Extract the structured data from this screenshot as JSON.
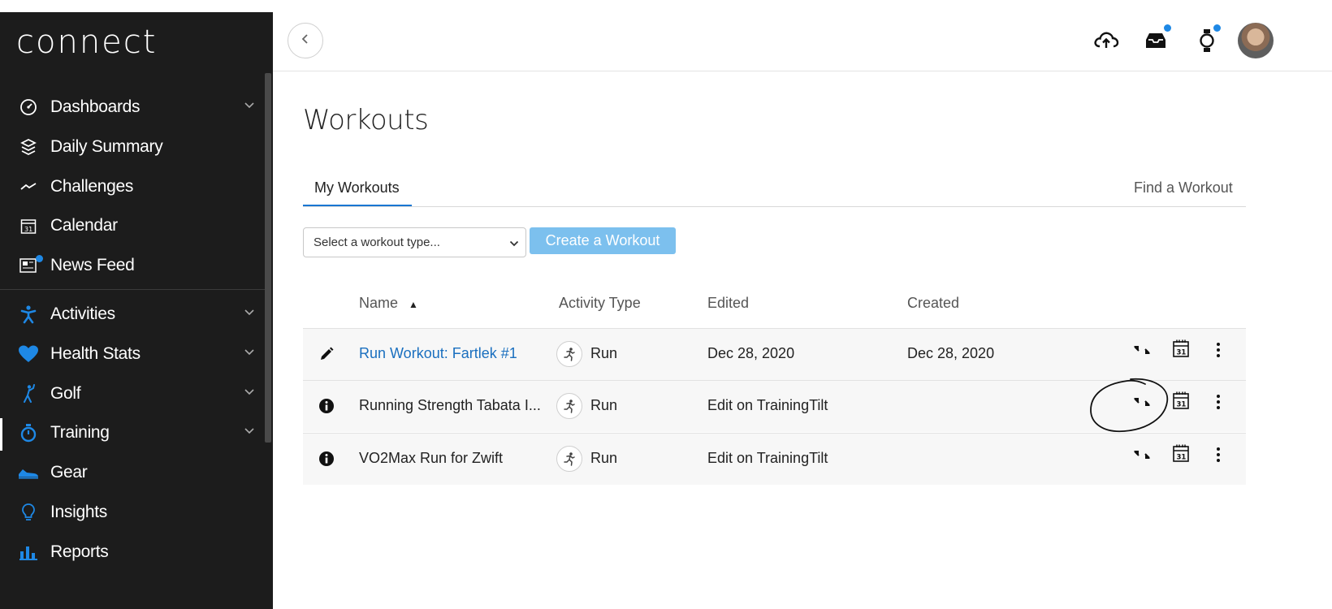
{
  "app": {
    "logo": "connect"
  },
  "sidebar": {
    "items": [
      {
        "label": "Dashboards",
        "icon": "gauge-icon",
        "chevron": true
      },
      {
        "label": "Daily Summary",
        "icon": "layers-icon",
        "chevron": false
      },
      {
        "label": "Challenges",
        "icon": "trend-icon",
        "chevron": false
      },
      {
        "label": "Calendar",
        "icon": "calendar-icon",
        "chevron": false
      },
      {
        "label": "News Feed",
        "icon": "newspaper-icon",
        "chevron": false
      },
      {
        "label": "Activities",
        "icon": "runner-icon",
        "chevron": true
      },
      {
        "label": "Health Stats",
        "icon": "heart-icon",
        "chevron": true
      },
      {
        "label": "Golf",
        "icon": "golf-icon",
        "chevron": true
      },
      {
        "label": "Training",
        "icon": "stopwatch-icon",
        "chevron": true,
        "active": true
      },
      {
        "label": "Gear",
        "icon": "shoe-icon",
        "chevron": false
      },
      {
        "label": "Insights",
        "icon": "lightbulb-icon",
        "chevron": false
      },
      {
        "label": "Reports",
        "icon": "bar-chart-icon",
        "chevron": false
      }
    ],
    "accent_color": "#1e88e5"
  },
  "topbar": {
    "icons": [
      "cloud-upload-icon",
      "inbox-icon",
      "watch-icon",
      "avatar"
    ]
  },
  "main": {
    "title": "Workouts",
    "tabs": [
      {
        "label": "My Workouts",
        "active": true
      },
      {
        "label": "Find a Workout",
        "active": false
      }
    ],
    "select": {
      "value": "Select a workout type..."
    },
    "create_button": "Create a Workout",
    "table": {
      "headers": {
        "name": "Name",
        "sort_arrow": "▲",
        "activity_type": "Activity Type",
        "edited": "Edited",
        "created": "Created"
      },
      "rows": [
        {
          "icon": "pencil-icon",
          "name": "Run Workout: Fartlek #1",
          "name_is_link": true,
          "activity": "Run",
          "edited": "Dec 28, 2020",
          "created": "Dec 28, 2020"
        },
        {
          "icon": "info-icon",
          "name": "Running Strength Tabata I...",
          "name_is_link": false,
          "activity": "Run",
          "edited": "Edit on TrainingTilt",
          "created": ""
        },
        {
          "icon": "info-icon",
          "name": "VO2Max Run for Zwift",
          "name_is_link": false,
          "activity": "Run",
          "edited": "Edit on TrainingTilt",
          "created": ""
        }
      ]
    }
  }
}
